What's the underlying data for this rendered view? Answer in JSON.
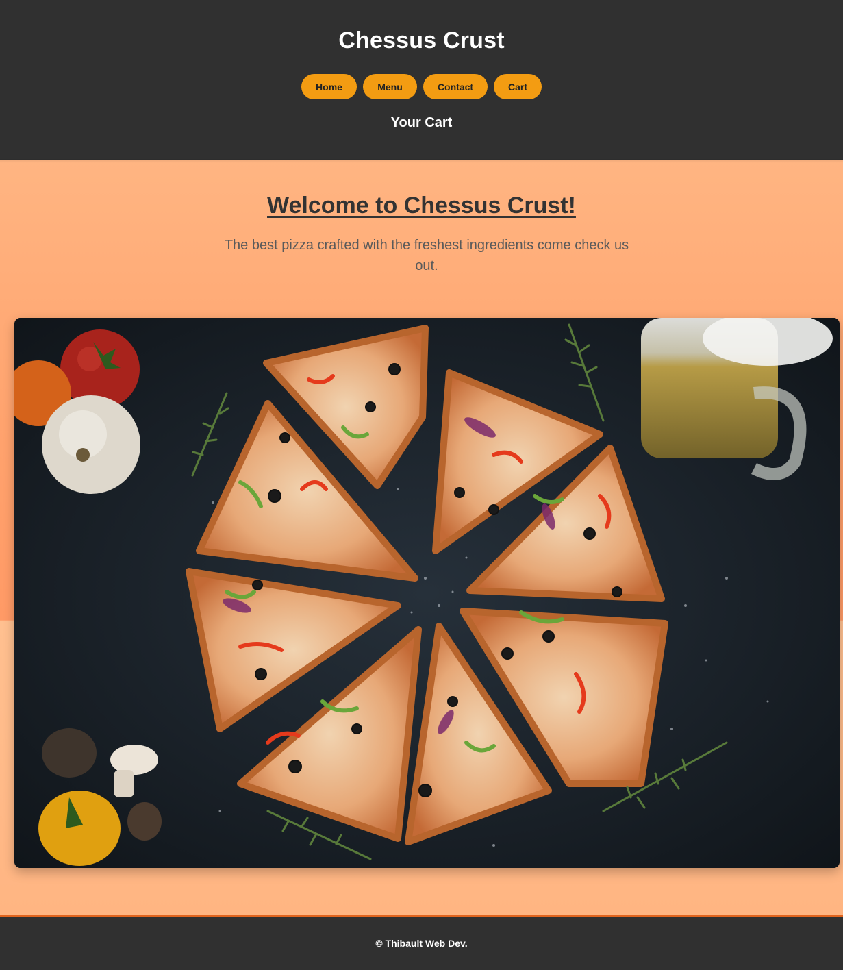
{
  "header": {
    "title": "Chessus Crust",
    "nav": [
      {
        "label": "Home"
      },
      {
        "label": "Menu"
      },
      {
        "label": "Contact"
      },
      {
        "label": "Cart"
      }
    ],
    "subtitle": "Your Cart"
  },
  "main": {
    "heading": "Welcome to Chessus Crust!",
    "tagline": "The best pizza crafted with the freshest ingredients come check us out.",
    "hero_image": "pizza-photo"
  },
  "footer": {
    "copyright": "© Thibault Web Dev."
  },
  "colors": {
    "header_bg": "#303030",
    "nav_button": "#f39c12",
    "main_bg": "#ffb582",
    "footer_border": "#e0641e"
  }
}
